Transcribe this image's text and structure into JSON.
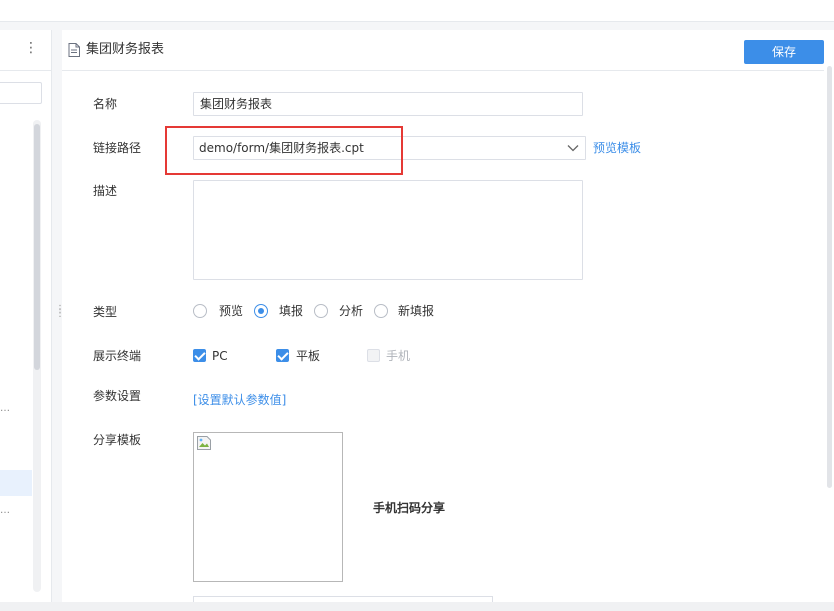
{
  "header": {
    "title": "集团财务报表",
    "save_label": "保存"
  },
  "form": {
    "name_label": "名称",
    "name_value": "集团财务报表",
    "path_label": "链接路径",
    "path_value": "demo/form/集团财务报表.cpt",
    "preview_link": "预览模板",
    "desc_label": "描述",
    "desc_value": "",
    "type_label": "类型",
    "type_options": [
      {
        "label": "预览",
        "checked": false
      },
      {
        "label": "填报",
        "checked": true
      },
      {
        "label": "分析",
        "checked": false
      },
      {
        "label": "新填报",
        "checked": false
      }
    ],
    "terminal_label": "展示终端",
    "terminals": [
      {
        "label": "PC",
        "checked": true,
        "disabled": false
      },
      {
        "label": "平板",
        "checked": true,
        "disabled": false
      },
      {
        "label": "手机",
        "checked": false,
        "disabled": true
      }
    ],
    "param_label": "参数设置",
    "param_link": "[设置默认参数值]",
    "share_label": "分享模板",
    "share_caption": "手机扫码分享"
  },
  "left_panel": {
    "more_icon": "kebab-icon",
    "truncated_items": [
      "…",
      "…"
    ]
  },
  "colors": {
    "accent": "#3c8ee8",
    "highlight": "#e53935"
  }
}
